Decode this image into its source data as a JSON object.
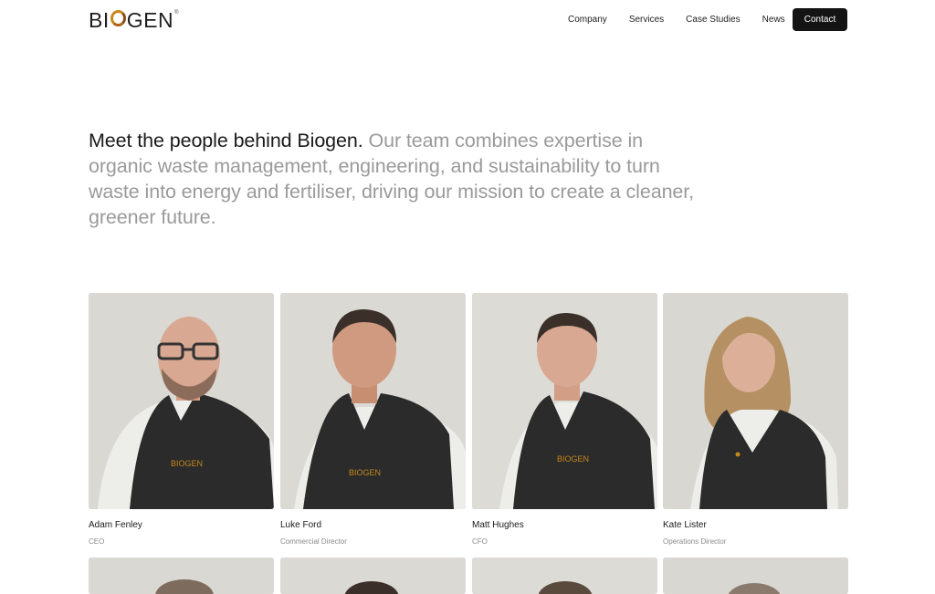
{
  "header": {
    "logo_text_before": "BI",
    "logo_text_after": "GEN",
    "logo_reg": "®",
    "nav": [
      "Company",
      "Services",
      "Case Studies",
      "News"
    ],
    "contact_label": "Contact"
  },
  "intro": {
    "lead": "Meet the people behind Biogen.",
    "rest": "Our team combines expertise in organic waste management, engineering, and sustainability to turn waste into energy and fertiliser, driving our mission to create a cleaner, greener future."
  },
  "team": [
    {
      "name": "Adam Fenley",
      "role": "CEO"
    },
    {
      "name": "Luke Ford",
      "role": "Commercial Director"
    },
    {
      "name": "Matt Hughes",
      "role": "CFO"
    },
    {
      "name": "Kate Lister",
      "role": "Operations Director"
    }
  ],
  "vest_logo": "BIOGEN",
  "colors": {
    "brand_orange": "#c6881b",
    "vest": "#2b2b2b",
    "photo_bg": "#d9d8d3",
    "button_bg": "#141414"
  }
}
